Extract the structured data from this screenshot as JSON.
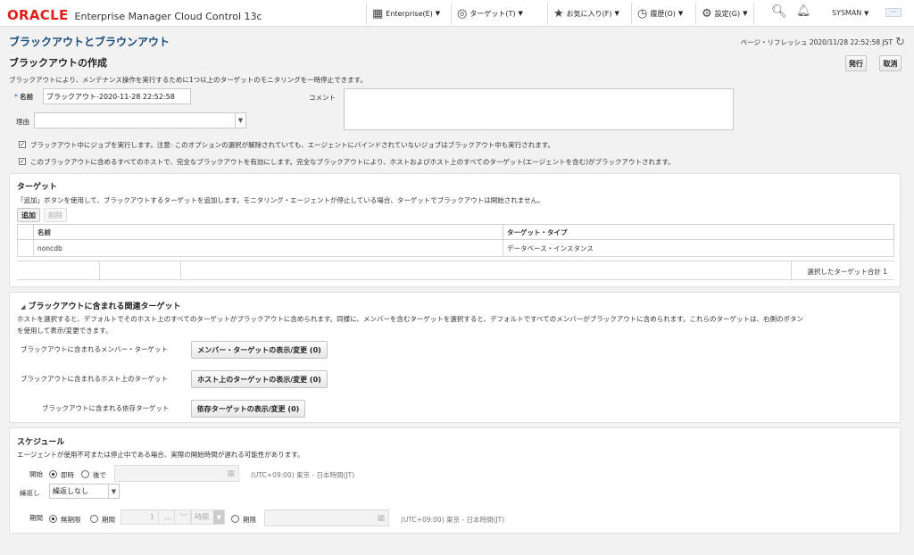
{
  "header": {
    "logo_oracle": "ORACLE",
    "logo_product": "Enterprise Manager Cloud Control 13c",
    "nav": [
      {
        "label": "Enterprise(E)",
        "icon": "grid-icon"
      },
      {
        "label": "ターゲット(T)",
        "icon": "target-icon"
      },
      {
        "label": "お気に入り(F)",
        "icon": "star-icon"
      },
      {
        "label": "履歴(O)",
        "icon": "clock-icon"
      },
      {
        "label": "設定(G)",
        "icon": "gear-icon"
      }
    ],
    "user": "SYSMAN",
    "more": "···"
  },
  "page": {
    "title": "ブラックアウトとブラウンアウト",
    "refresh_label": "ページ・リフレッシュ 2020/11/28 22:52:58 JST",
    "subtitle": "ブラックアウトの作成",
    "submit": "発行",
    "cancel": "取消",
    "description": "ブラックアウトにより、メンテナンス操作を実行するために1つ以上のターゲットのモニタリングを一時停止できます。"
  },
  "form": {
    "required_mark": "*",
    "name_label": "名前",
    "name_value": "ブラックアウト-2020-11-28 22:52:58",
    "comment_label": "コメント",
    "comment_value": "",
    "reason_label": "理由",
    "reason_value": "",
    "check1": "ブラックアウト中にジョブを実行します。注意: このオプションの選択が解除されていても、エージェントにバインドされていないジョブはブラックアウト中も実行されます。",
    "check2": "このブラックアウトに含めるすべてのホストで、完全なブラックアウトを有効にします。完全なブラックアウトにより、ホストおよびホスト上のすべてのターゲット(エージェントを含む)がブラックアウトされます。"
  },
  "targets": {
    "title": "ターゲット",
    "text": "「追加」ボタンを使用して、ブラックアウトするターゲットを追加します。モニタリング・エージェントが停止している場合、ターゲットでブラックアウトは開始されません。",
    "add": "追加",
    "remove": "削除",
    "columns": [
      "名前",
      "ターゲット・タイプ"
    ],
    "rows": [
      [
        "noncdb",
        "データベース・インスタンス"
      ]
    ],
    "total": "選択したターゲット合計 1"
  },
  "related": {
    "title": "ブラックアウトに含まれる関連ターゲット",
    "text1": "ホストを選択すると、デフォルトでそのホスト上のすべてのターゲットがブラックアウトに含められます。同様に、メンバーを含むターゲットを選択すると、デフォルトですべてのメンバーがブラックアウトに含められます。これらのターゲットは、右側のボタン",
    "text2": "を使用して表示/変更できます。",
    "row1_label": "ブラックアウトに含まれるメンバー・ターゲット",
    "row1_btn": "メンバー・ターゲットの表示/変更 (0)",
    "row2_label": "ブラックアウトに含まれるホスト上のターゲット",
    "row2_btn": "ホスト上のターゲットの表示/変更 (0)",
    "row3_label": "ブラックアウトに含まれる依存ターゲット",
    "row3_btn": "依存ターゲットの表示/変更 (0)"
  },
  "schedule": {
    "title": "スケジュール",
    "text": "エージェントが使用不可または停止中である場合、実際の開始時間が遅れる可能性があります。",
    "start_label": "開始",
    "start_now": "即時",
    "start_later": "後で",
    "timezone": "(UTC+09:00) 東京 - 日本時間(JT)",
    "repeat_label": "繰返し",
    "repeat_value": "繰返しなし",
    "duration_label": "期間",
    "indefinite": "無期限",
    "length": "期間",
    "length_value": "1",
    "unit": "時間",
    "until": "期限",
    "timezone2": "(UTC+09:00) 東京 - 日本時間(JT)"
  }
}
